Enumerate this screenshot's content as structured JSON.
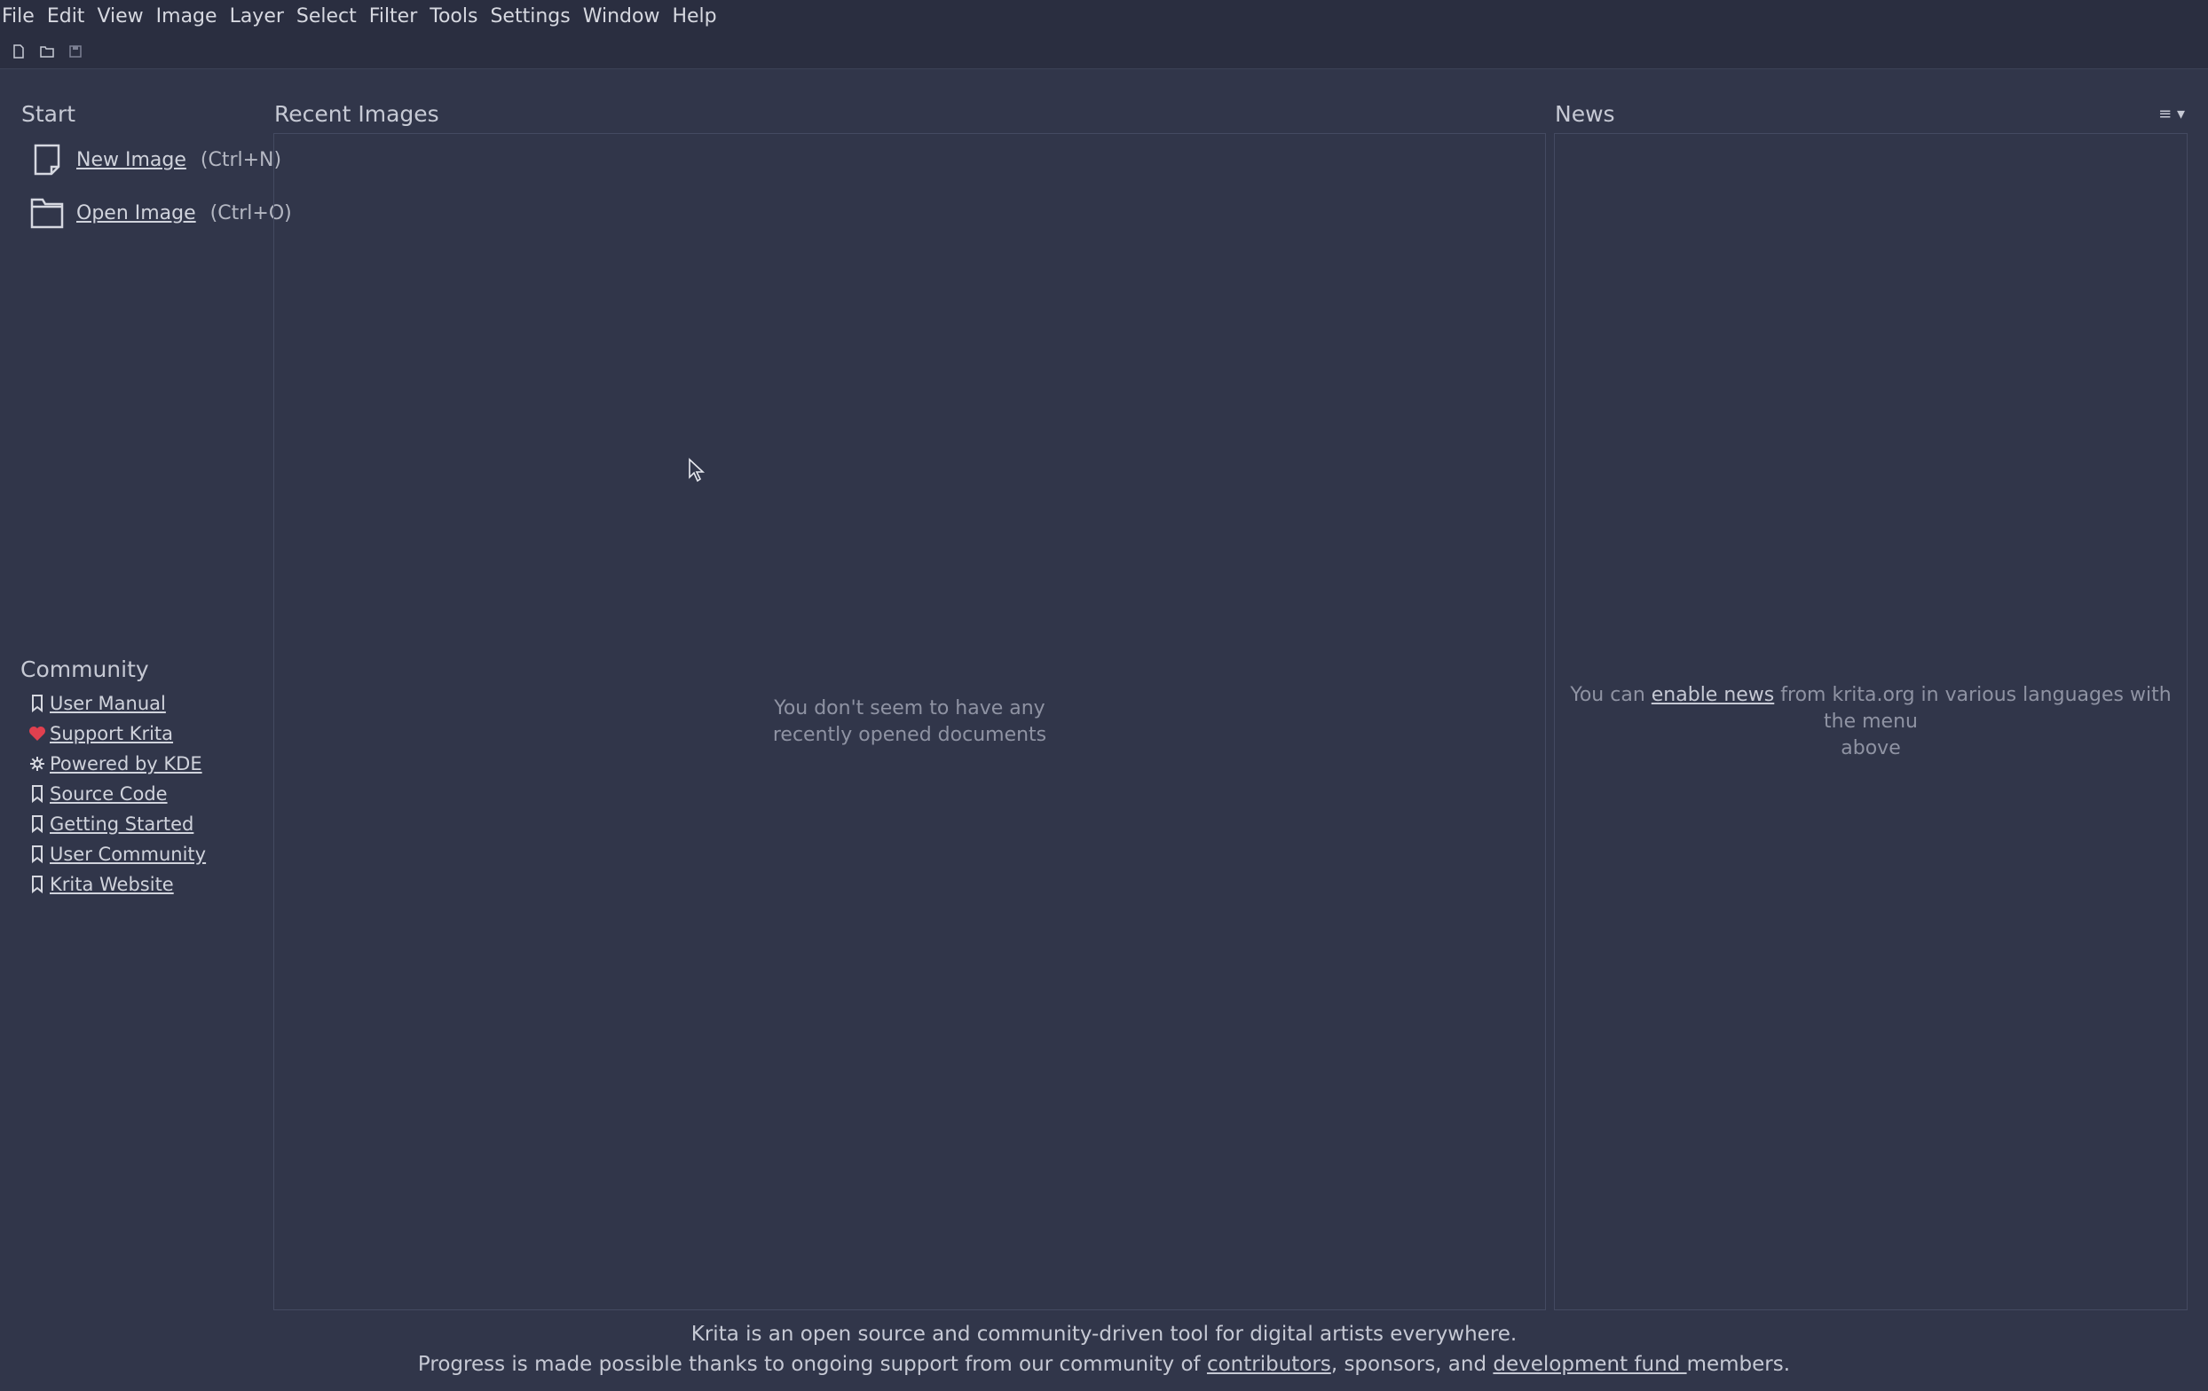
{
  "menubar": {
    "items": [
      "File",
      "Edit",
      "View",
      "Image",
      "Layer",
      "Select",
      "Filter",
      "Tools",
      "Settings",
      "Window",
      "Help"
    ]
  },
  "toolbar": {
    "icons": [
      "new-document-icon",
      "open-folder-icon",
      "save-icon"
    ]
  },
  "start": {
    "title": "Start",
    "new_image": {
      "label": "New Image",
      "shortcut": "(Ctrl+N)"
    },
    "open_image": {
      "label": "Open Image",
      "shortcut": "(Ctrl+O)"
    }
  },
  "recent": {
    "title": "Recent Images",
    "empty_line1": "You don't seem to have any",
    "empty_line2": "recently opened documents"
  },
  "news": {
    "title": "News",
    "menu_glyph": "≡ ▾",
    "text_prefix": "You can ",
    "link": "enable news",
    "text_suffix": " from krita.org in various languages with the menu",
    "text_line2": "above"
  },
  "community": {
    "title": "Community",
    "items": [
      {
        "label": "User Manual",
        "icon": "bookmark-icon"
      },
      {
        "label": "Support Krita",
        "icon": "heart-icon"
      },
      {
        "label": "Powered by KDE",
        "icon": "kde-gear-icon"
      },
      {
        "label": "Source Code",
        "icon": "bookmark-icon"
      },
      {
        "label": "Getting Started",
        "icon": "bookmark-icon"
      },
      {
        "label": "User Community",
        "icon": "bookmark-icon"
      },
      {
        "label": "Krita Website",
        "icon": "bookmark-icon"
      }
    ]
  },
  "footer": {
    "line1": "Krita is an open source and community-driven tool for digital artists everywhere.",
    "line2_a": "Progress is made possible thanks to ongoing support from our community of ",
    "link1": "contributors",
    "line2_b": ", sponsors, and ",
    "link2": "development fund ",
    "line2_c": "members."
  },
  "colors": {
    "background": "#31364a",
    "menubar": "#2a2e40",
    "heart": "#e0404f"
  }
}
